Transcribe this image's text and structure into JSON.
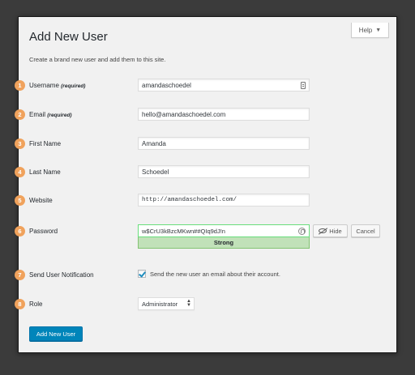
{
  "help": {
    "label": "Help"
  },
  "page": {
    "title": "Add New User",
    "subtitle": "Create a brand new user and add them to this site."
  },
  "fields": {
    "username": {
      "step": "1",
      "label": "Username",
      "required": "(required)",
      "value": "amandaschoedel"
    },
    "email": {
      "step": "2",
      "label": "Email",
      "required": "(required)",
      "value": "hello@amandaschoedel.com"
    },
    "first_name": {
      "step": "3",
      "label": "First Name",
      "value": "Amanda"
    },
    "last_name": {
      "step": "4",
      "label": "Last Name",
      "value": "Schoedel"
    },
    "website": {
      "step": "5",
      "label": "Website",
      "value": "http://amandaschoedel.com/"
    },
    "password": {
      "step": "6",
      "label": "Password",
      "value": "w$CrU3kBzcMKwn##QIq9dJ!n",
      "strength": "Strong",
      "hide_label": "Hide",
      "cancel_label": "Cancel"
    },
    "notification": {
      "step": "7",
      "label": "Send User Notification",
      "checkbox_text": "Send the new user an email about their account.",
      "checked": true
    },
    "role": {
      "step": "8",
      "label": "Role",
      "value": "Administrator"
    }
  },
  "submit": {
    "label": "Add New User"
  },
  "colors": {
    "badge": "#f0a25c",
    "primary": "#0085ba",
    "strength_bg": "#c1e1b9"
  }
}
